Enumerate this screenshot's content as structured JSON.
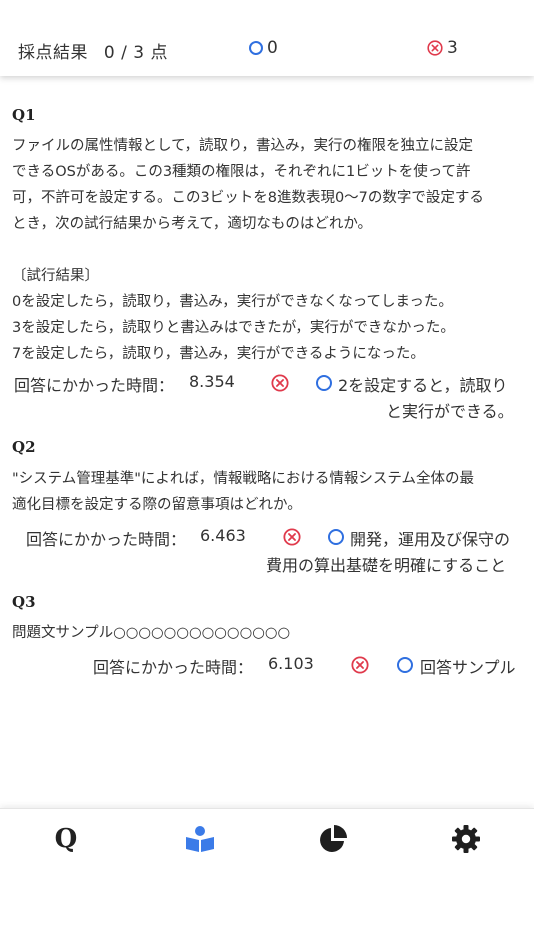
{
  "header": {
    "score_label": "採点結果",
    "score_value": "0 / 3 点",
    "correct_count": "0",
    "wrong_count": "3"
  },
  "questions": [
    {
      "label": "Q1",
      "text_lines": [
        "ファイルの属性情報として，読取り，書込み，実行の権限を独立に設定",
        "できるOSがある。この3種類の権限は，それぞれに1ビットを使って許",
        "可，不許可を設定する。この3ビットを8進数表現0〜7の数字で設定する",
        "とき，次の試行結果から考えて，適切なものはどれか。",
        "",
        "〔試行結果〕",
        "0を設定したら，読取り，書込み，実行ができなくなってしまった。",
        "3を設定したら，読取りと書込みはできたが，実行ができなかった。",
        "7を設定したら，読取り，書込み，実行ができるようになった。"
      ],
      "time_label": "回答にかかった時間：",
      "time_value": "8.354",
      "answer_lines": [
        "2を設定すると，読取り",
        "と実行ができる。"
      ]
    },
    {
      "label": "Q2",
      "text_lines": [
        "\"システム管理基準\"によれば，情報戦略における情報システム全体の最",
        "適化目標を設定する際の留意事項はどれか。"
      ],
      "time_label": "回答にかかった時間：",
      "time_value": "6.463",
      "answer_lines": [
        "開発，運用及び保守の",
        "費用の算出基礎を明確にすること"
      ]
    },
    {
      "label": "Q3",
      "text_lines": [
        "問題文サンプル○○○○○○○○○○○○○○"
      ],
      "time_label": "回答にかかった時間：",
      "time_value": "6.103",
      "answer_lines": [
        "回答サンプル"
      ]
    }
  ],
  "tabs": [
    {
      "icon": "q-logo-icon",
      "label": "Q"
    },
    {
      "icon": "book-reader-icon"
    },
    {
      "icon": "pie-chart-icon"
    },
    {
      "icon": "gear-icon"
    }
  ],
  "colors": {
    "blue": "#2f6fe0",
    "red": "#e03a4c"
  }
}
